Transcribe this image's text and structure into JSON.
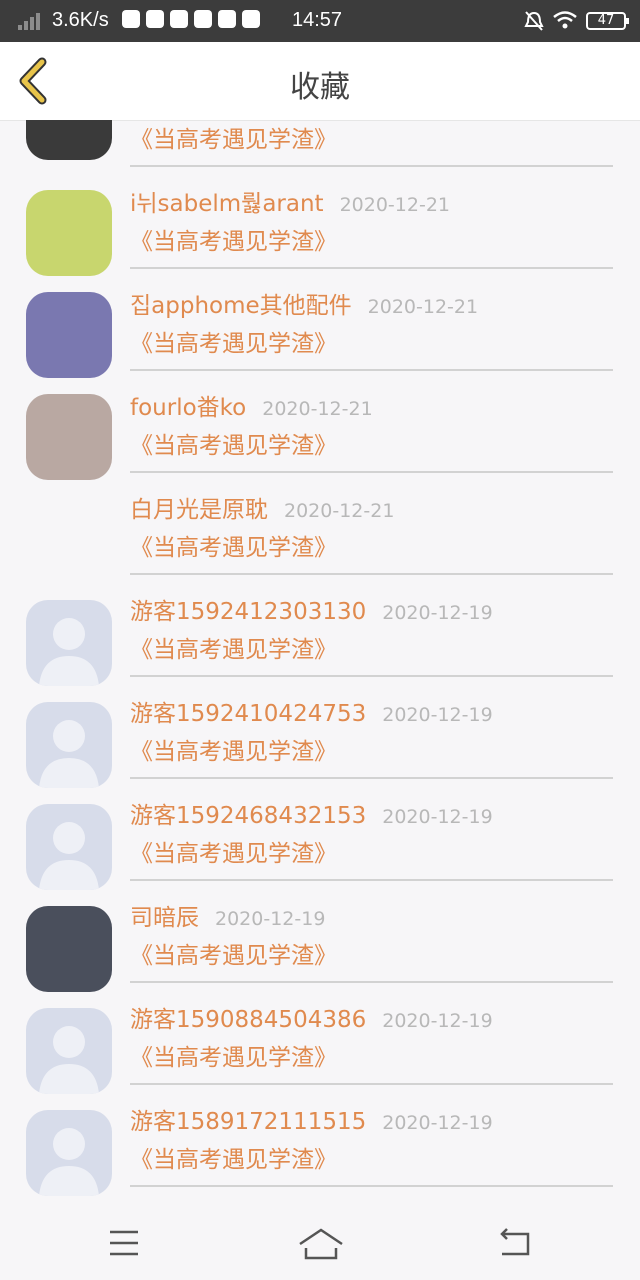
{
  "status_bar": {
    "speed": "3.6K/s",
    "time": "14:57",
    "battery": "47"
  },
  "header": {
    "title": "收藏"
  },
  "favorites": [
    {
      "name": "",
      "date": "",
      "book": "《当高考遇见学渣》",
      "avatar": "photo"
    },
    {
      "name": "i뉘sabelm뤓arant",
      "date": "2020-12-21",
      "book": "《当高考遇见学渣》",
      "avatar": "photo"
    },
    {
      "name": "집apphome其他配件",
      "date": "2020-12-21",
      "book": "《当高考遇见学渣》",
      "avatar": "photo"
    },
    {
      "name": "fourlo畨ko",
      "date": "2020-12-21",
      "book": "《当高考遇见学渣》",
      "avatar": "photo"
    },
    {
      "name": "白月光是原耽",
      "date": "2020-12-21",
      "book": "《当高考遇见学渣》",
      "avatar": "none"
    },
    {
      "name": "游客1592412303130",
      "date": "2020-12-19",
      "book": "《当高考遇见学渣》",
      "avatar": "default"
    },
    {
      "name": "游客1592410424753",
      "date": "2020-12-19",
      "book": "《当高考遇见学渣》",
      "avatar": "default"
    },
    {
      "name": "游客1592468432153",
      "date": "2020-12-19",
      "book": "《当高考遇见学渣》",
      "avatar": "default"
    },
    {
      "name": "司暗辰",
      "date": "2020-12-19",
      "book": "《当高考遇见学渣》",
      "avatar": "photo"
    },
    {
      "name": "游客1590884504386",
      "date": "2020-12-19",
      "book": "《当高考遇见学渣》",
      "avatar": "default"
    },
    {
      "name": "游客1589172111515",
      "date": "2020-12-19",
      "book": "《当高考遇见学渣》",
      "avatar": "default"
    }
  ],
  "colors": {
    "accent": "#e08a4e",
    "back_icon": "#e8c44a",
    "date": "#b8b8b8"
  },
  "icons": {
    "back": "chevron-left-icon",
    "menu": "menu-icon",
    "home": "home-icon",
    "return": "return-icon"
  }
}
